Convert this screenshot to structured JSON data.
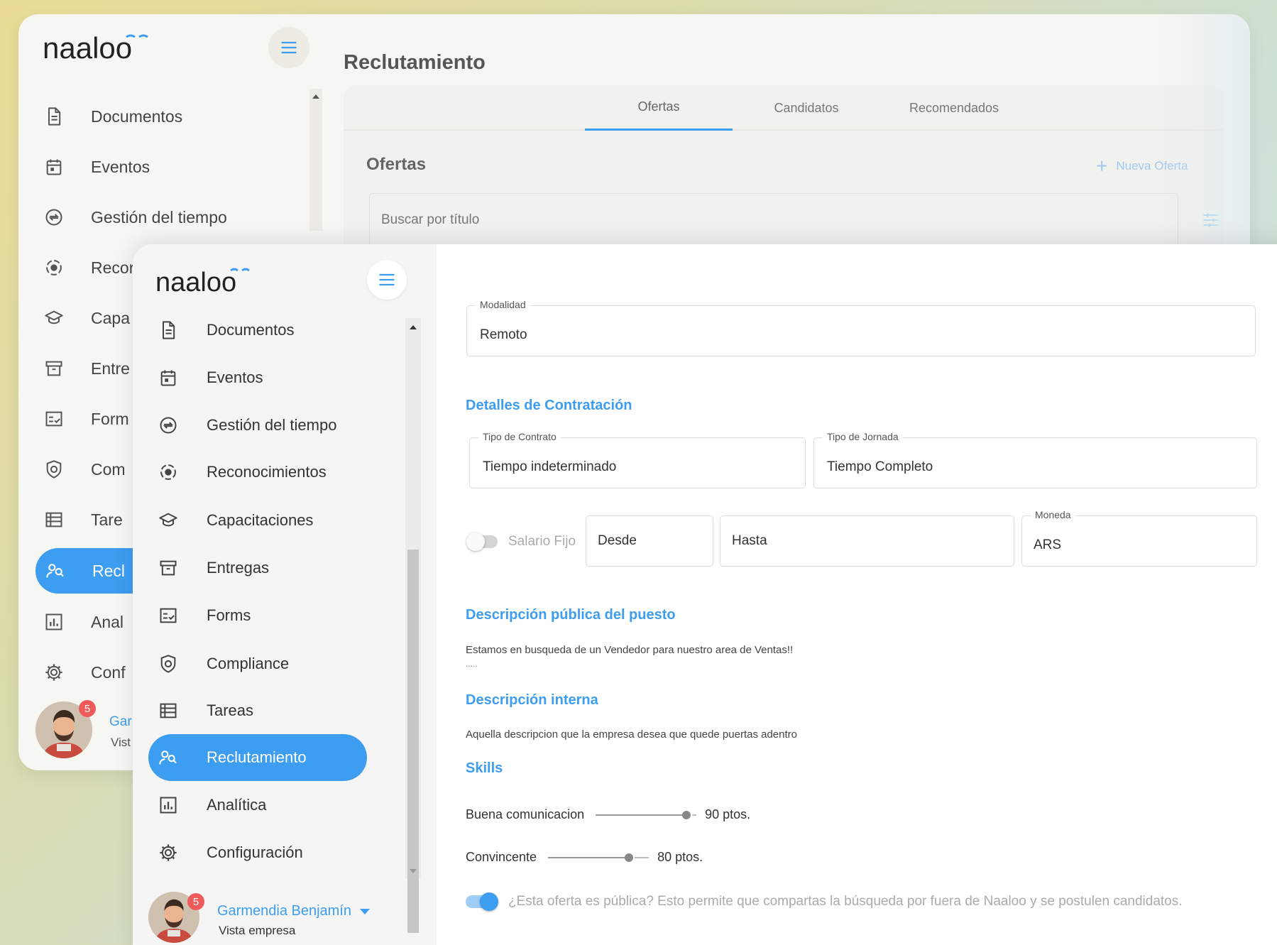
{
  "brand": {
    "logo_text": "naaloo",
    "accent": "#3d9df0"
  },
  "back_window": {
    "page_title": "Reclutamiento",
    "nav_items": [
      {
        "label": "Documentos",
        "icon": "document-icon"
      },
      {
        "label": "Eventos",
        "icon": "calendar-icon"
      },
      {
        "label": "Gestión del tiempo",
        "icon": "time-exchange-icon"
      },
      {
        "label": "Recor",
        "icon": "recognition-icon"
      },
      {
        "label": "Capa",
        "icon": "graduation-cap-icon"
      },
      {
        "label": "Entre",
        "icon": "archive-box-icon"
      },
      {
        "label": "Form",
        "icon": "checklist-icon"
      },
      {
        "label": "Com",
        "icon": "shield-icon"
      },
      {
        "label": "Tare",
        "icon": "list-icon"
      },
      {
        "label": "Recl",
        "icon": "recruitment-icon"
      },
      {
        "label": "Anal",
        "icon": "analytics-icon"
      },
      {
        "label": "Conf",
        "icon": "gear-icon"
      }
    ],
    "tabs": [
      {
        "label": "Ofertas"
      },
      {
        "label": "Candidatos"
      },
      {
        "label": "Recomendados"
      }
    ],
    "section_title": "Ofertas",
    "new_offer_label": "Nueva Oferta",
    "search_placeholder": "Buscar por título",
    "user_name": "Gar",
    "user_role": "Vist",
    "notification_count": "5"
  },
  "sidebar": {
    "nav_items": [
      {
        "label": "Documentos",
        "icon": "document-icon"
      },
      {
        "label": "Eventos",
        "icon": "calendar-icon"
      },
      {
        "label": "Gestión del tiempo",
        "icon": "time-exchange-icon"
      },
      {
        "label": "Reconocimientos",
        "icon": "recognition-icon"
      },
      {
        "label": "Capacitaciones",
        "icon": "graduation-cap-icon"
      },
      {
        "label": "Entregas",
        "icon": "archive-box-icon"
      },
      {
        "label": "Forms",
        "icon": "checklist-icon"
      },
      {
        "label": "Compliance",
        "icon": "shield-icon"
      },
      {
        "label": "Tareas",
        "icon": "list-icon"
      },
      {
        "label": "Reclutamiento",
        "icon": "recruitment-icon",
        "active": true
      },
      {
        "label": "Analítica",
        "icon": "analytics-icon"
      },
      {
        "label": "Configuración",
        "icon": "gear-icon"
      }
    ],
    "user": {
      "name": "Garmendia Benjamín",
      "role": "Vista empresa",
      "notification_count": "5"
    }
  },
  "form": {
    "modalidad": {
      "label": "Modalidad",
      "value": "Remoto"
    },
    "hiring_section_title": "Detalles de Contratación",
    "contract_type": {
      "label": "Tipo de Contrato",
      "value": "Tiempo indeterminado"
    },
    "workday_type": {
      "label": "Tipo de Jornada",
      "value": "Tiempo Completo"
    },
    "fixed_salary_label": "Salario Fijo",
    "fixed_salary_enabled": false,
    "salary_from_placeholder": "Desde",
    "salary_to_placeholder": "Hasta",
    "currency": {
      "label": "Moneda",
      "value": "ARS"
    },
    "public_desc_title": "Descripción pública del puesto",
    "public_desc_text": "Estamos en busqueda de un Vendedor para nuestro area de Ventas!!",
    "public_desc_more": ".....",
    "internal_desc_title": "Descripción interna",
    "internal_desc_text": "Aquella descripcion que la empresa desea que quede puertas adentro",
    "skills_title": "Skills",
    "skills": [
      {
        "name": "Buena comunicacion",
        "points": 90,
        "points_label": "90 ptos."
      },
      {
        "name": "Convincente",
        "points": 80,
        "points_label": "80 ptos."
      }
    ],
    "public_offer_enabled": true,
    "public_offer_label": "¿Esta oferta es pública? Esto permite que compartas la búsqueda por fuera de Naaloo y se postulen candidatos."
  }
}
